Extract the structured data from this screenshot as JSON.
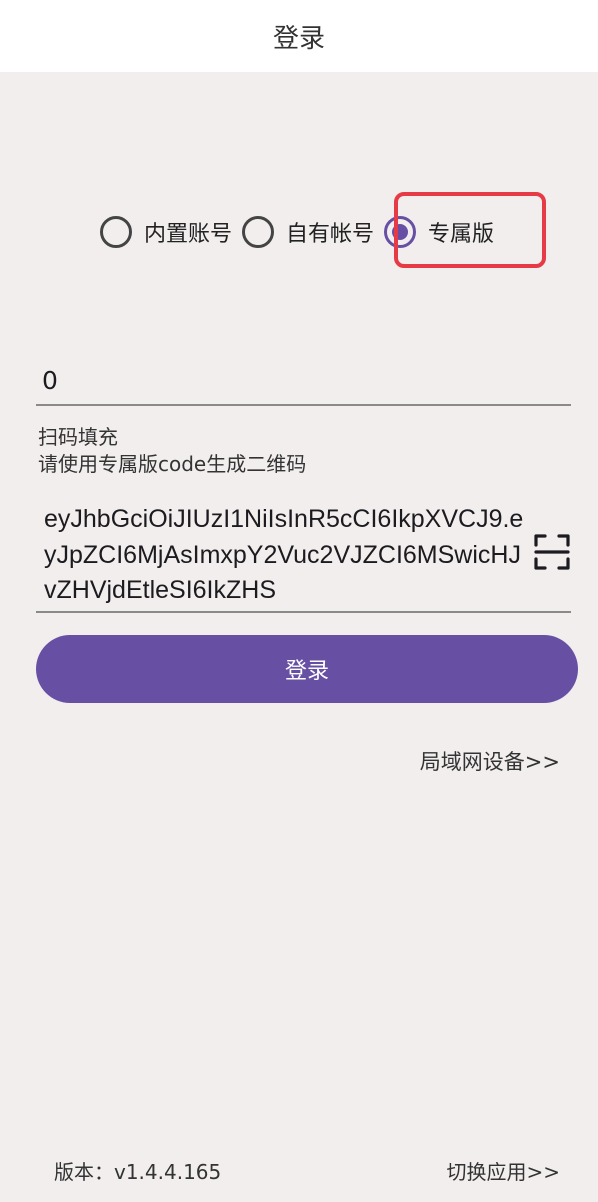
{
  "header": {
    "title": "登录"
  },
  "login_type": {
    "options": [
      {
        "label": "内置账号",
        "selected": false
      },
      {
        "label": "自有帐号",
        "selected": false
      },
      {
        "label": "专属版",
        "selected": true
      }
    ]
  },
  "form": {
    "id_value": "0",
    "scan_label": "扫码填充",
    "scan_hint": "请使用专属版code生成二维码",
    "code_value": "eyJhbGciOiJIUzI1NiIsInR5cCI6IkpXVCJ9.eyJpZCI6MjAsImxpY2Vuc2VJZCI6MSwicHJvZHVjdEtleSI6IkZHS",
    "login_label": "登录"
  },
  "links": {
    "lan_devices": "局域网设备>>",
    "switch_app": "切换应用>>"
  },
  "footer": {
    "version": "版本：v1.4.4.165"
  },
  "colors": {
    "accent": "#6750a4",
    "highlight": "#e63a46",
    "background": "#f2eeee"
  },
  "icons": {
    "scan": "scan-frame-icon"
  }
}
